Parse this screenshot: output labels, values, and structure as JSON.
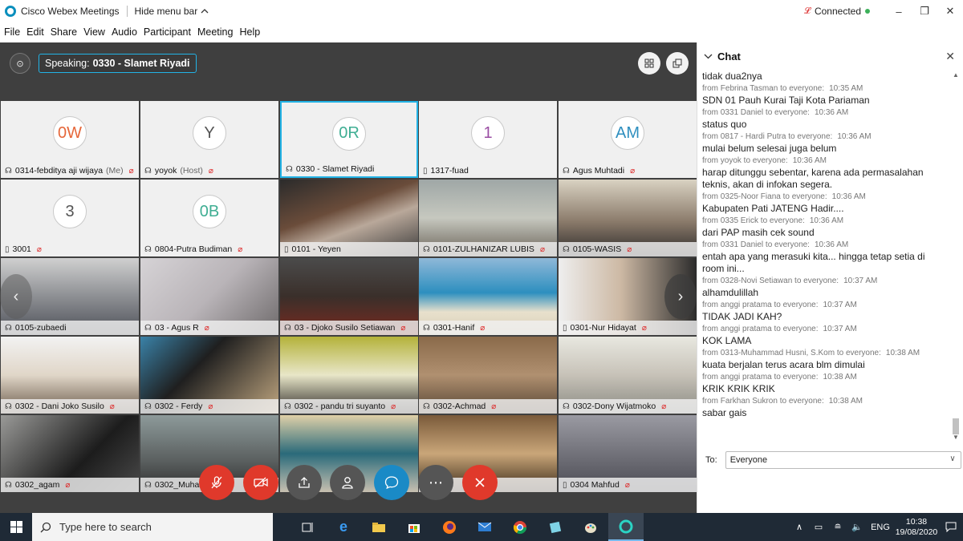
{
  "app": {
    "title": "Cisco Webex Meetings",
    "hide_menu": "Hide menu bar",
    "status": "Connected"
  },
  "menu": [
    "File",
    "Edit",
    "Share",
    "View",
    "Audio",
    "Participant",
    "Meeting",
    "Help"
  ],
  "speaking": {
    "prefix": "Speaking:",
    "name": "0330 - Slamet Riyadi"
  },
  "tiles": [
    {
      "name": "0314-febditya aji wijaya",
      "role": "(Me)",
      "initials": "0W",
      "initials_color": "#e6673a",
      "device": "headset",
      "muted": true
    },
    {
      "name": "yoyok",
      "role": "(Host)",
      "initials": "Y",
      "initials_color": "#555555",
      "device": "headset",
      "muted": true
    },
    {
      "name": "0330 - Slamet Riyadi",
      "role": "",
      "initials": "0R",
      "initials_color": "#3fae93",
      "device": "headset",
      "muted": false,
      "active": true
    },
    {
      "name": "1317-fuad",
      "role": "",
      "initials": "1",
      "initials_color": "#9a4da3",
      "device": "phone",
      "muted": false
    },
    {
      "name": "Agus Muhtadi",
      "role": "",
      "initials": "AM",
      "initials_color": "#2f8fbf",
      "device": "headset",
      "muted": true
    },
    {
      "name": "3001",
      "role": "",
      "initials": "3",
      "initials_color": "#555555",
      "device": "phone",
      "muted": true
    },
    {
      "name": "0804-Putra Budiman",
      "role": "",
      "initials": "0B",
      "initials_color": "#3fae93",
      "device": "headset",
      "muted": true
    },
    {
      "name": "0101 - Yeyen",
      "role": "",
      "device": "phone",
      "muted": false
    },
    {
      "name": "0101-ZULHANIZAR LUBIS",
      "role": "",
      "device": "headset",
      "muted": true
    },
    {
      "name": "0105-WASIS",
      "role": "",
      "device": "headset",
      "muted": true
    },
    {
      "name": "0105-zubaedi",
      "role": "",
      "device": "headset",
      "muted": false
    },
    {
      "name": "03 - Agus R",
      "role": "",
      "device": "headset",
      "muted": true
    },
    {
      "name": "03 - Djoko Susilo Setiawan",
      "role": "",
      "device": "headset",
      "muted": true
    },
    {
      "name": "0301-Hanif",
      "role": "",
      "device": "headset",
      "muted": true
    },
    {
      "name": "0301-Nur Hidayat",
      "role": "",
      "device": "phone",
      "muted": true
    },
    {
      "name": "0302 - Dani Joko Susilo",
      "role": "",
      "device": "headset",
      "muted": true
    },
    {
      "name": "0302 - Ferdy",
      "role": "",
      "device": "headset",
      "muted": true
    },
    {
      "name": "0302 - pandu tri suyanto",
      "role": "",
      "device": "headset",
      "muted": true
    },
    {
      "name": "0302-Achmad",
      "role": "",
      "device": "headset",
      "muted": true
    },
    {
      "name": "0302-Dony Wijatmoko",
      "role": "",
      "device": "headset",
      "muted": true
    },
    {
      "name": "0302_agam",
      "role": "",
      "device": "headset",
      "muted": true
    },
    {
      "name": "0302_Muha",
      "role": "",
      "device": "headset",
      "muted": false
    },
    {
      "name": "",
      "role": "",
      "device": "",
      "muted": false
    },
    {
      "name": "d Rifan",
      "role": "",
      "device": "",
      "muted": false
    },
    {
      "name": "0304 Mahfud",
      "role": "",
      "device": "phone",
      "muted": true
    }
  ],
  "chat": {
    "title": "Chat",
    "to_label": "To:",
    "to_value": "Everyone",
    "messages": [
      {
        "text": "tidak dua2nya",
        "from": "from Febrina Tasman to everyone:",
        "time": "10:35 AM"
      },
      {
        "text": "SDN 01 Pauh Kurai Taji Kota Pariaman",
        "from": "from 0331 Daniel to everyone:",
        "time": "10:36 AM"
      },
      {
        "text": "status quo",
        "from": "from 0817 - Hardi Putra to everyone:",
        "time": "10:36 AM"
      },
      {
        "text": "mulai belum selesai juga belum",
        "from": "from yoyok to everyone:",
        "time": "10:36 AM"
      },
      {
        "text": "harap ditunggu sebentar, karena ada permasalahan teknis, akan di infokan segera.",
        "from": "from 0325-Noor Fiana to everyone:",
        "time": "10:36 AM"
      },
      {
        "text": "Kabupaten Pati JATENG Hadir....",
        "from": "from 0335 Erick to everyone:",
        "time": "10:36 AM"
      },
      {
        "text": "dari PAP masih cek sound",
        "from": "from 0331 Daniel to everyone:",
        "time": "10:36 AM"
      },
      {
        "text": "entah apa yang merasuki kita... hingga tetap setia di room ini...",
        "from": "from 0328-Novi Setiawan to everyone:",
        "time": "10:37 AM"
      },
      {
        "text": "alhamdulillah",
        "from": "from anggi pratama to everyone:",
        "time": "10:37 AM"
      },
      {
        "text": "TIDAK JADI KAH?",
        "from": "from anggi pratama to everyone:",
        "time": "10:37 AM"
      },
      {
        "text": "KOK LAMA",
        "from": "from 0313-Muhammad Husni, S.Kom to everyone:",
        "time": "10:38 AM"
      },
      {
        "text": "kuata berjalan terus acara blm dimulai",
        "from": "from anggi pratama to everyone:",
        "time": "10:38 AM"
      },
      {
        "text": "KRIK KRIK KRIK",
        "from": "from Farkhan Sukron to everyone:",
        "time": "10:38 AM"
      },
      {
        "text": "sabar gais",
        "from": "",
        "time": ""
      }
    ]
  },
  "taskbar": {
    "search_placeholder": "Type here to search",
    "lang": "ENG",
    "time": "10:38",
    "date": "19/08/2020"
  }
}
